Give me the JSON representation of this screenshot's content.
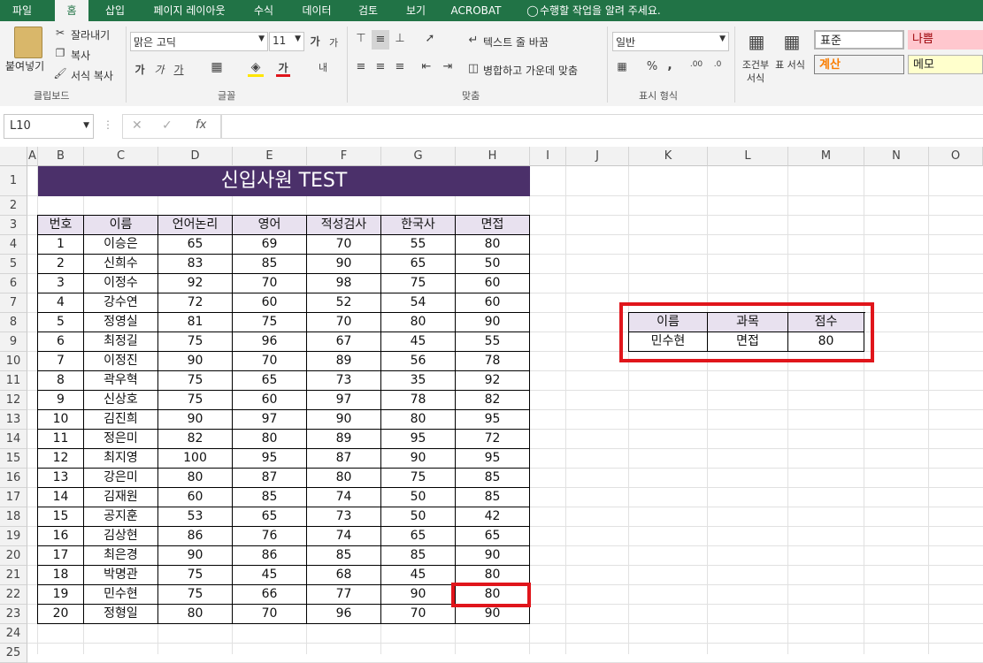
{
  "ribbon_tabs": [
    "파일",
    "홈",
    "삽입",
    "페이지 레이아웃",
    "수식",
    "데이터",
    "검토",
    "보기",
    "ACROBAT",
    "수행할 작업을 알려 주세요."
  ],
  "clipboard": {
    "paste": "붙여넣기",
    "cut": "잘라내기",
    "copy": "복사",
    "format_painter": "서식 복사",
    "group": "클립보드"
  },
  "font": {
    "name": "맑은 고딕",
    "size": "11",
    "group": "글꼴"
  },
  "alignment": {
    "wrap_text": "텍스트 줄 바꿈",
    "merge_center": "병합하고 가운데 맞춤",
    "group": "맞춤"
  },
  "number": {
    "format": "일반",
    "group": "표시 형식"
  },
  "styles": {
    "conditional": "조건부 서식",
    "table": "표 서식",
    "normal": "표준",
    "bad": "나쁨",
    "calc": "계산",
    "memo": "메모"
  },
  "formula_bar": {
    "name_box": "L10",
    "fx": "fx",
    "value": ""
  },
  "columns": [
    "A",
    "B",
    "C",
    "D",
    "E",
    "F",
    "G",
    "H",
    "I",
    "J",
    "K",
    "L",
    "M",
    "N",
    "O"
  ],
  "rows": [
    "1",
    "2",
    "3",
    "4",
    "5",
    "6",
    "7",
    "8",
    "9",
    "10",
    "11",
    "12",
    "13",
    "14",
    "15",
    "16",
    "17",
    "18",
    "19",
    "20",
    "21",
    "22",
    "23",
    "24",
    "25"
  ],
  "sheet": {
    "title": "신입사원 TEST",
    "headers": [
      "번호",
      "이름",
      "언어논리",
      "영어",
      "적성검사",
      "한국사",
      "면접"
    ],
    "data": [
      [
        "1",
        "이승은",
        "65",
        "69",
        "70",
        "55",
        "80"
      ],
      [
        "2",
        "신희수",
        "83",
        "85",
        "90",
        "65",
        "50"
      ],
      [
        "3",
        "이정수",
        "92",
        "70",
        "98",
        "75",
        "60"
      ],
      [
        "4",
        "강수연",
        "72",
        "60",
        "52",
        "54",
        "60"
      ],
      [
        "5",
        "정영실",
        "81",
        "75",
        "70",
        "80",
        "90"
      ],
      [
        "6",
        "최정길",
        "75",
        "96",
        "67",
        "45",
        "55"
      ],
      [
        "7",
        "이정진",
        "90",
        "70",
        "89",
        "56",
        "78"
      ],
      [
        "8",
        "곽우혁",
        "75",
        "65",
        "73",
        "35",
        "92"
      ],
      [
        "9",
        "신상호",
        "75",
        "60",
        "97",
        "78",
        "82"
      ],
      [
        "10",
        "김진희",
        "90",
        "97",
        "90",
        "80",
        "95"
      ],
      [
        "11",
        "정은미",
        "82",
        "80",
        "89",
        "95",
        "72"
      ],
      [
        "12",
        "최지영",
        "100",
        "95",
        "87",
        "90",
        "95"
      ],
      [
        "13",
        "강은미",
        "80",
        "87",
        "80",
        "75",
        "85"
      ],
      [
        "14",
        "김재원",
        "60",
        "85",
        "74",
        "50",
        "85"
      ],
      [
        "15",
        "공지훈",
        "53",
        "65",
        "73",
        "50",
        "42"
      ],
      [
        "16",
        "김상현",
        "86",
        "76",
        "74",
        "65",
        "65"
      ],
      [
        "17",
        "최은경",
        "90",
        "86",
        "85",
        "85",
        "90"
      ],
      [
        "18",
        "박명관",
        "75",
        "45",
        "68",
        "45",
        "80"
      ],
      [
        "19",
        "민수현",
        "75",
        "66",
        "77",
        "90",
        "80"
      ],
      [
        "20",
        "정형일",
        "80",
        "70",
        "96",
        "70",
        "90"
      ]
    ],
    "lookup_headers": [
      "이름",
      "과목",
      "점수"
    ],
    "lookup_values": [
      "민수현",
      "면접",
      "80"
    ]
  },
  "colors": {
    "accent": "#217346",
    "title_bg": "#4b306a",
    "header_fill": "#e8e1ef",
    "highlight": "#e0151b"
  }
}
